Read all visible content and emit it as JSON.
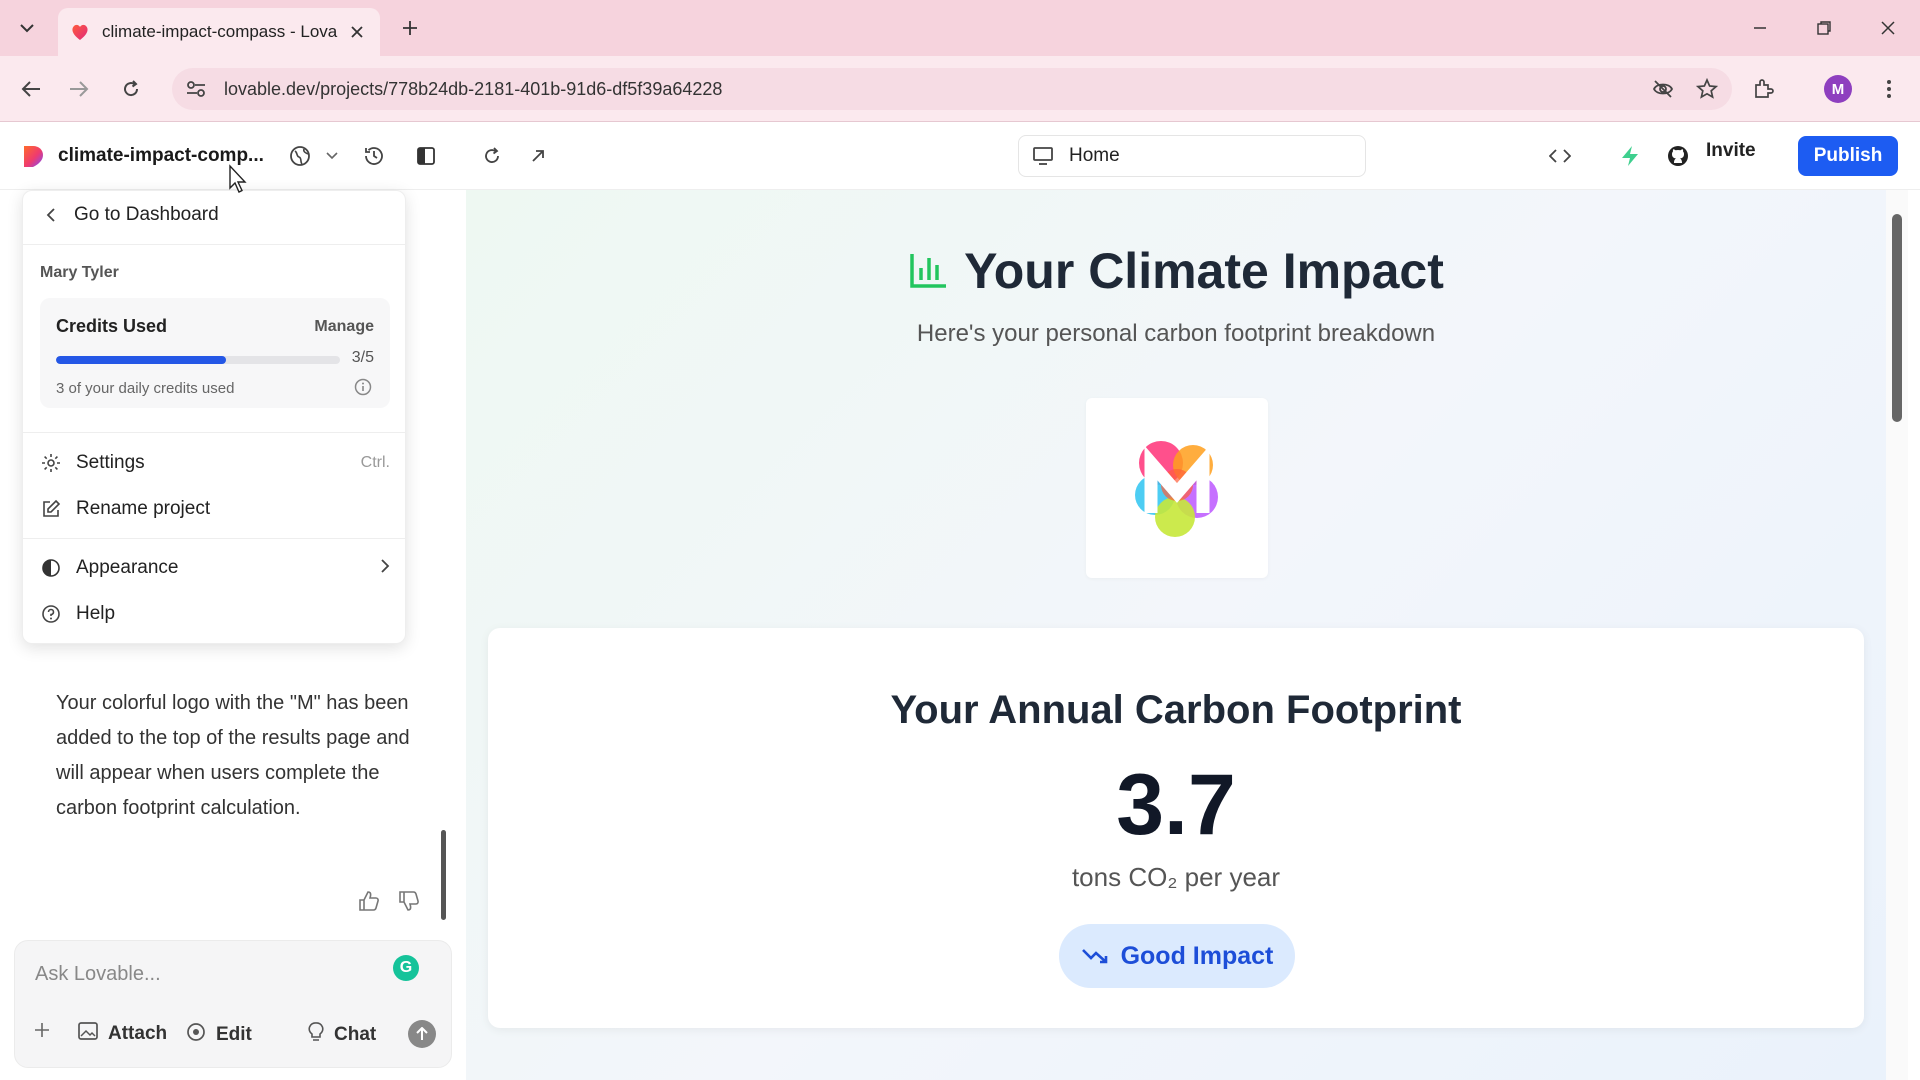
{
  "browser": {
    "tab_title": "climate-impact-compass - Lova",
    "url": "lovable.dev/projects/778b24db-2181-401b-91d6-df5f39a64228",
    "profile_initial": "M"
  },
  "app": {
    "project_name": "climate-impact-comp...",
    "route_label": "Home",
    "invite_label": "Invite",
    "publish_label": "Publish"
  },
  "menu": {
    "back_label": "Go to Dashboard",
    "user_name": "Mary Tyler",
    "credits": {
      "title": "Credits Used",
      "manage_label": "Manage",
      "used": 3,
      "total": 5,
      "ratio_text": "3/5",
      "note": "3 of your daily credits used"
    },
    "items": [
      {
        "label": "Settings",
        "shortcut": "Ctrl.",
        "icon": "gear-icon"
      },
      {
        "label": "Rename project",
        "shortcut": "",
        "icon": "edit-icon"
      },
      {
        "label": "Appearance",
        "shortcut": "",
        "icon": "contrast-icon"
      },
      {
        "label": "Help",
        "shortcut": "",
        "icon": "help-icon"
      }
    ]
  },
  "chat": {
    "message": "Your colorful logo with the \"M\" has been added to the top of the results page and will appear when users complete the carbon footprint calculation.",
    "input_placeholder": "Ask Lovable...",
    "attach_label": "Attach",
    "edit_label": "Edit",
    "chat_label": "Chat"
  },
  "preview": {
    "title": "Your Climate Impact",
    "subtitle": "Here's your personal carbon footprint breakdown",
    "card_title": "Your Annual Carbon Footprint",
    "value": "3.7",
    "unit": "tons CO₂ per year",
    "badge": "Good Impact"
  },
  "colors": {
    "publish": "#1d5cf2",
    "progress": "#2457e6",
    "title_icon": "#22c55e",
    "badge_bg": "#dbeafe",
    "badge_text": "#1d4ed8"
  }
}
